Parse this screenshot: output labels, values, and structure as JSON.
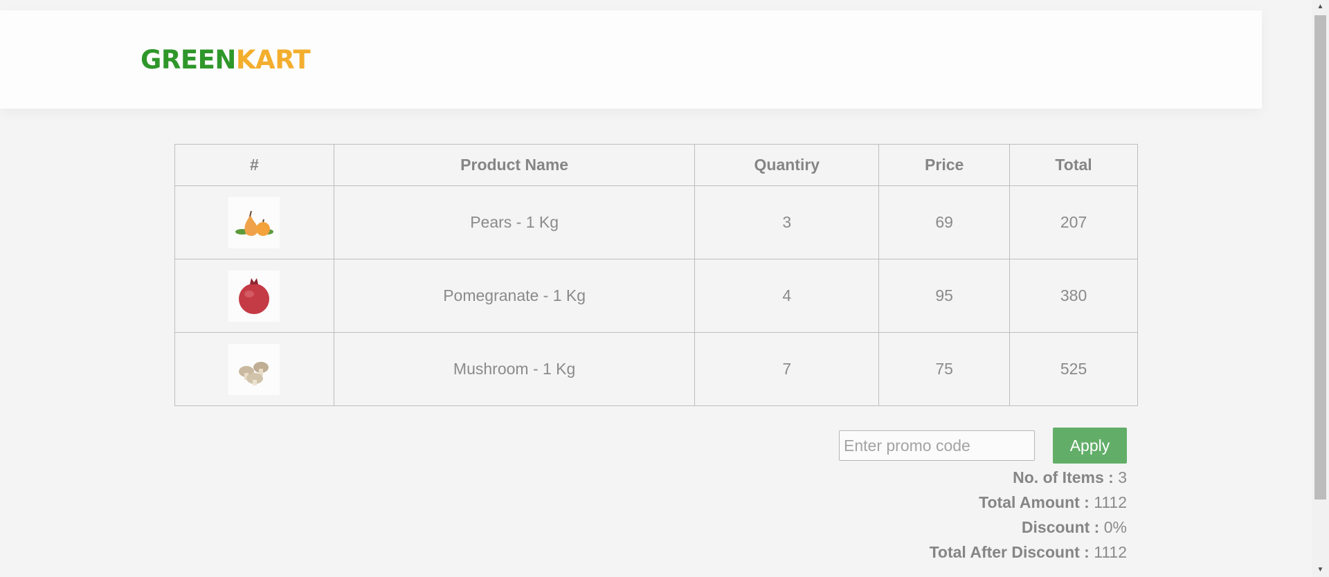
{
  "brand": {
    "part1": "GREEN",
    "part2": "KART"
  },
  "table": {
    "headers": [
      "#",
      "Product Name",
      "Quantiry",
      "Price",
      "Total"
    ],
    "rows": [
      {
        "image": "pears-image",
        "name": "Pears - 1 Kg",
        "quantity": "3",
        "price": "69",
        "total": "207"
      },
      {
        "image": "pomegranate-image",
        "name": "Pomegranate - 1 Kg",
        "quantity": "4",
        "price": "95",
        "total": "380"
      },
      {
        "image": "mushroom-image",
        "name": "Mushroom - 1 Kg",
        "quantity": "7",
        "price": "75",
        "total": "525"
      }
    ]
  },
  "promo": {
    "placeholder": "Enter promo code",
    "value": "",
    "button": "Apply"
  },
  "summary": {
    "items_label": "No. of Items :",
    "items_value": "3",
    "amount_label": "Total Amount :",
    "amount_value": "1112",
    "discount_label": "Discount :",
    "discount_value": "0%",
    "after_label": "Total After Discount :",
    "after_value": "1112"
  },
  "scrollbar": {
    "up_icon": "▲",
    "down_icon": "▼"
  },
  "colors": {
    "brand_green": "#2f972a",
    "brand_orange": "#f3ae2e",
    "apply_button": "#62ae69"
  }
}
